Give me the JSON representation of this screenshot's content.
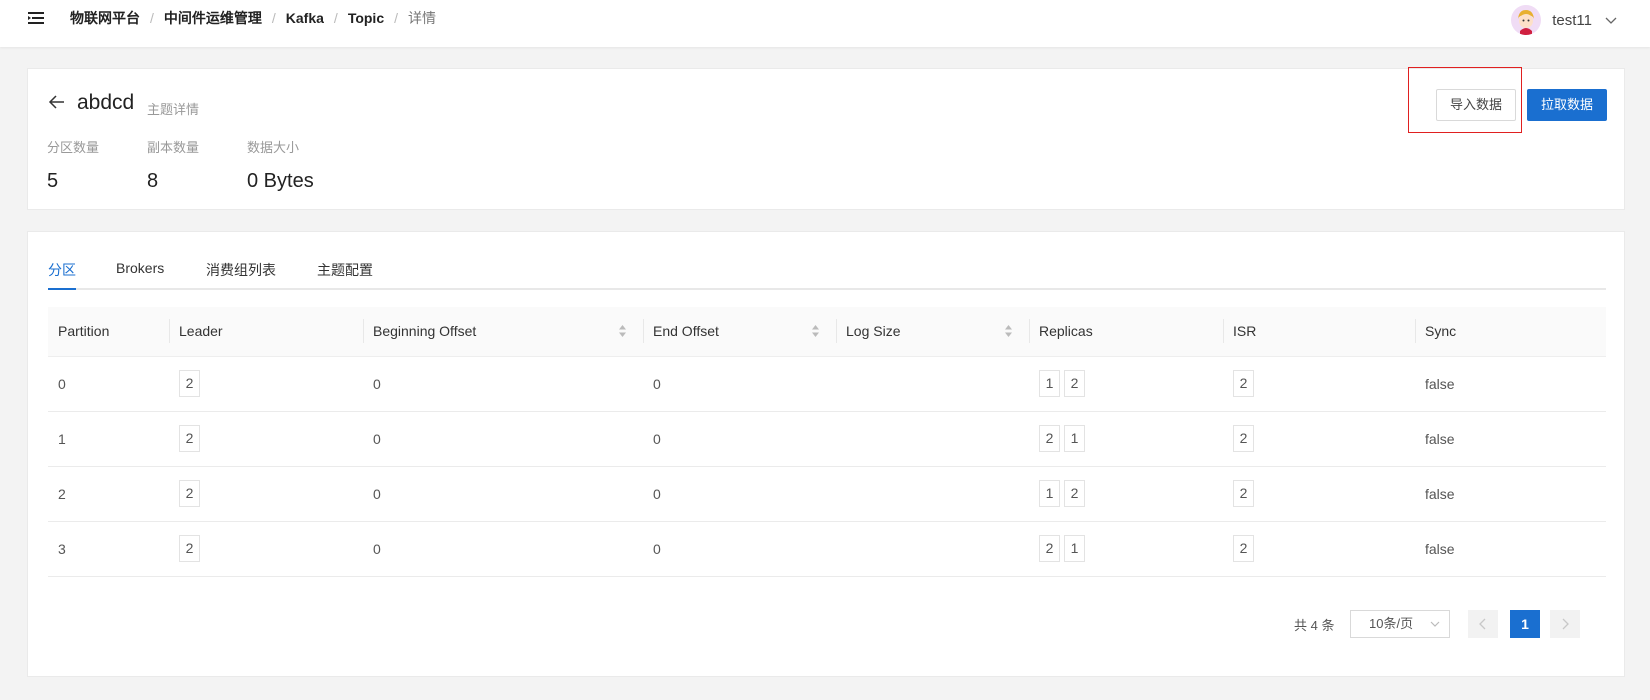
{
  "header": {
    "breadcrumb": [
      "物联网平台",
      "中间件运维管理",
      "Kafka",
      "Topic",
      "详情"
    ],
    "user": {
      "name": "test11"
    }
  },
  "topic": {
    "name": "abdcd",
    "subtitle": "主题详情",
    "stats": [
      {
        "label": "分区数量",
        "value": "5"
      },
      {
        "label": "副本数量",
        "value": "8"
      },
      {
        "label": "数据大小",
        "value": "0 Bytes"
      }
    ],
    "buttons": {
      "import": "导入数据",
      "pull": "拉取数据"
    }
  },
  "tabs": [
    {
      "label": "分区",
      "active": true
    },
    {
      "label": "Brokers",
      "active": false
    },
    {
      "label": "消费组列表",
      "active": false
    },
    {
      "label": "主题配置",
      "active": false
    }
  ],
  "table": {
    "columns": [
      "Partition",
      "Leader",
      "Beginning Offset",
      "End Offset",
      "Log Size",
      "Replicas",
      "ISR",
      "Sync"
    ],
    "rows": [
      {
        "partition": "0",
        "leader": "2",
        "beginning_offset": "0",
        "end_offset": "0",
        "log_size": "",
        "replicas": [
          "1",
          "2"
        ],
        "isr": [
          "2"
        ],
        "sync": "false"
      },
      {
        "partition": "1",
        "leader": "2",
        "beginning_offset": "0",
        "end_offset": "0",
        "log_size": "",
        "replicas": [
          "2",
          "1"
        ],
        "isr": [
          "2"
        ],
        "sync": "false"
      },
      {
        "partition": "2",
        "leader": "2",
        "beginning_offset": "0",
        "end_offset": "0",
        "log_size": "",
        "replicas": [
          "1",
          "2"
        ],
        "isr": [
          "2"
        ],
        "sync": "false"
      },
      {
        "partition": "3",
        "leader": "2",
        "beginning_offset": "0",
        "end_offset": "0",
        "log_size": "",
        "replicas": [
          "2",
          "1"
        ],
        "isr": [
          "2"
        ],
        "sync": "false"
      }
    ]
  },
  "pagination": {
    "total_text": "共 4 条",
    "page_size": "10条/页",
    "current_page": "1"
  },
  "colors": {
    "primary": "#1a6fd0",
    "highlight": "#e02020"
  }
}
